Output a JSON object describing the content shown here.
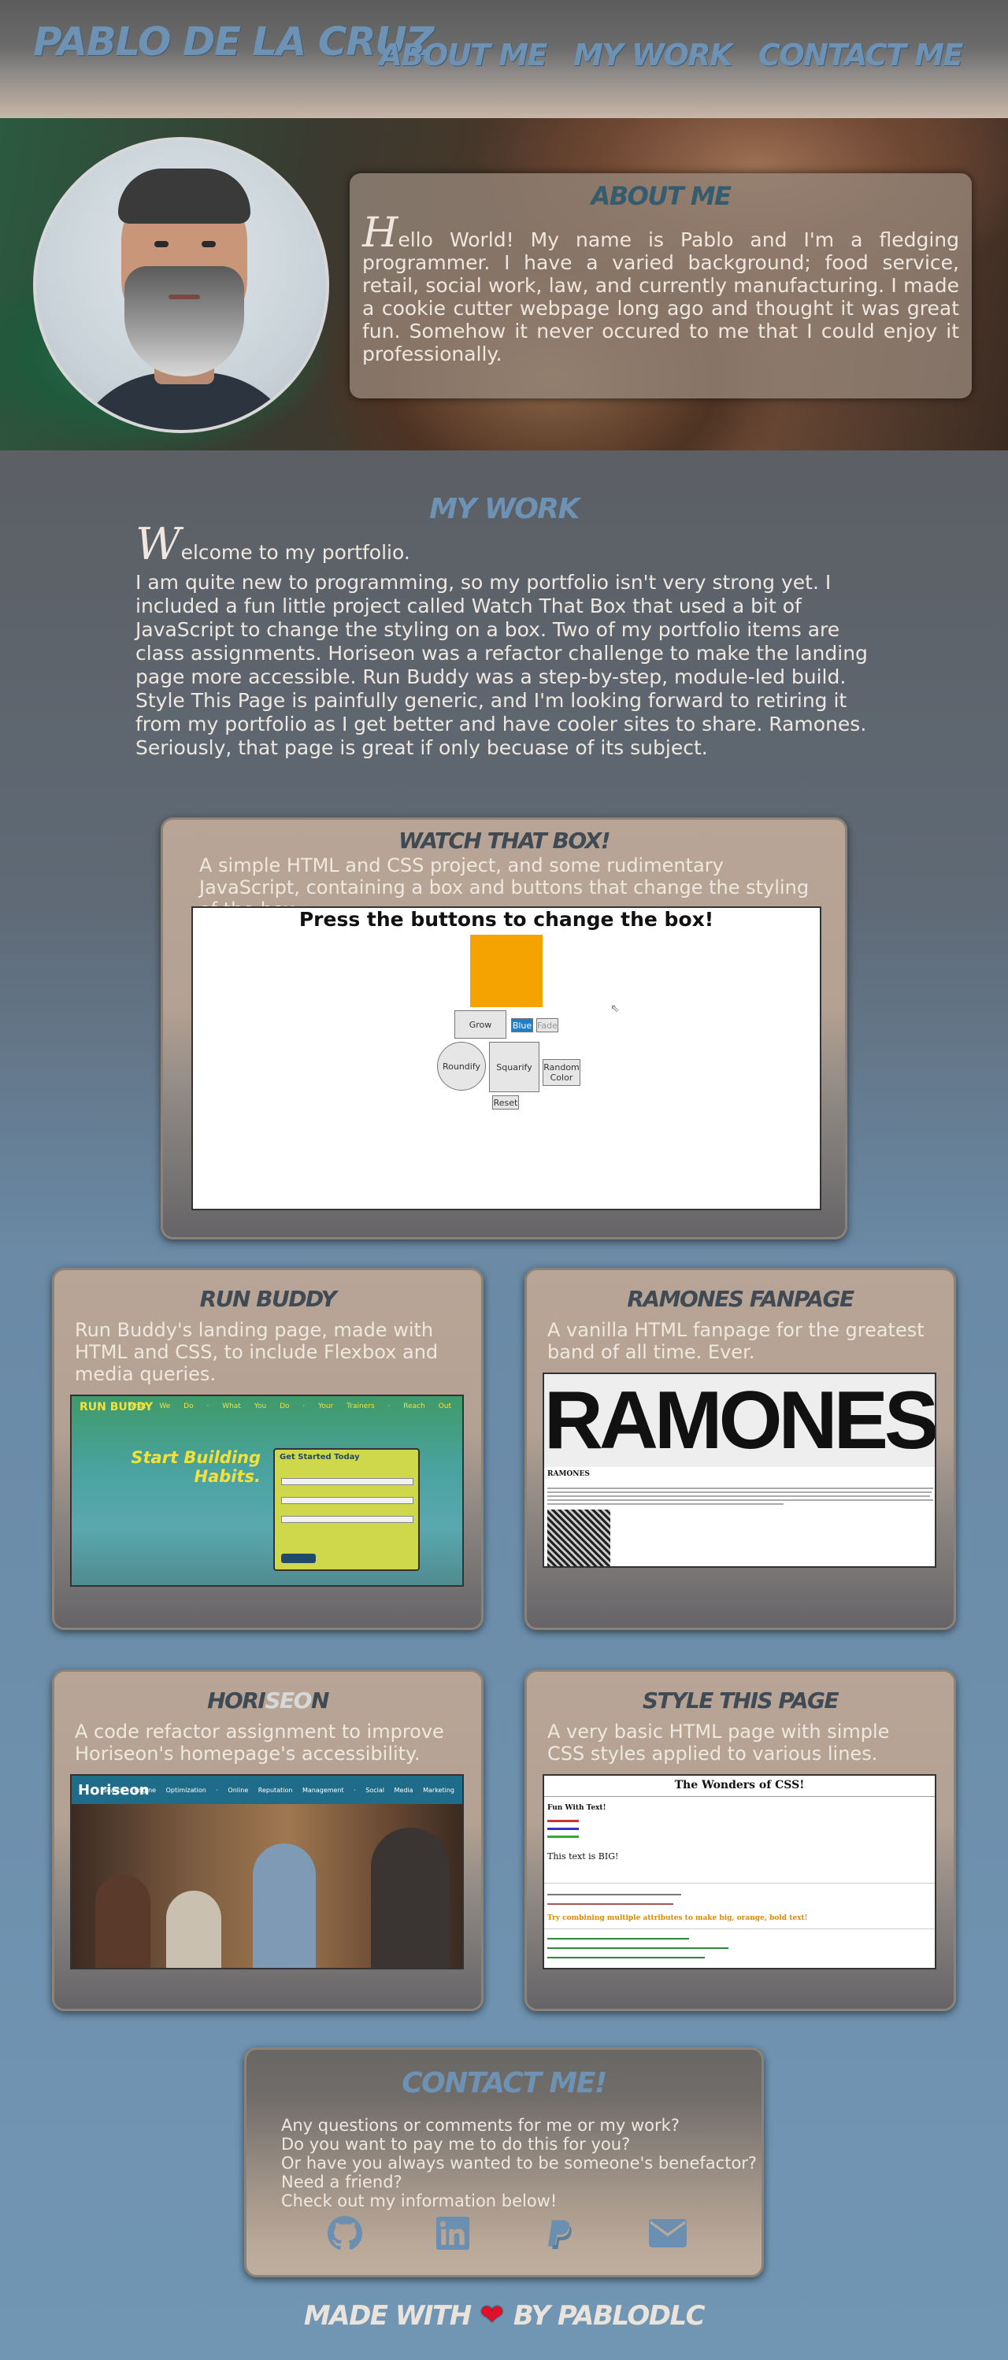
{
  "header": {
    "site_title": "PABLO DE LA CRUZ",
    "nav": [
      {
        "label": "ABOUT ME"
      },
      {
        "label": "MY WORK"
      },
      {
        "label": "CONTACT ME"
      }
    ]
  },
  "about": {
    "title": "ABOUT ME",
    "dropcap": "H",
    "text": "ello World! My name is Pablo and I'm a fledging programmer. I have a varied background; food service, retail, social work, law, and currently manufacturing. I made a cookie cutter webpage long ago and thought it was great fun. Somehow it never occured to me that I could enjoy it professionally."
  },
  "work": {
    "title": "MY WORK",
    "welcome_dropcap": "W",
    "welcome": "elcome to my portfolio.",
    "intro": "I am quite new to programming, so my portfolio isn't very strong yet. I included a fun little project called Watch That Box that used a bit of JavaScript to change the styling on a box. Two of my portfolio items are class assignments. Horiseon was a refactor challenge to make the landing page more accessible. Run Buddy was a step-by-step, module-led build. Style This Page is painfully generic, and I'm looking forward to retiring it from my portfolio as I get better and have cooler sites to share. Ramones. Seriously, that page is great if only becuase of its subject."
  },
  "projects": {
    "watch": {
      "title": "WATCH THAT BOX!",
      "desc": "A simple HTML and CSS project, and some rudimentary JavaScript, containing a box and buttons that change the styling of the box.",
      "shot": {
        "heading": "Press the buttons to change the box!",
        "grow": "Grow",
        "blue": "Blue",
        "fade": "Fade",
        "roundify": "Roundify",
        "squarify": "Squarify",
        "random": "Random Color",
        "reset": "Reset"
      }
    },
    "runbuddy": {
      "title": "RUN BUDDY",
      "desc": "Run Buddy's landing page, made with HTML and CSS, to include Flexbox and media queries.",
      "shot": {
        "logo": "RUN BUDDY",
        "nav": "What We Do · What You Do · Your Trainers · Reach Out",
        "hero": "Start Building Habits.",
        "form_title": "Get Started Today"
      }
    },
    "ramones": {
      "title": "RAMONES FANPAGE",
      "desc": "A vanilla HTML fanpage for the greatest band of all time. Ever.",
      "shot": {
        "logo": "RAMONES",
        "heading": "RAMONES"
      }
    },
    "horiseon": {
      "title_a": "HORI",
      "title_b": "SEO",
      "title_c": "N",
      "desc": "A code refactor assignment to improve Horiseon's homepage's accessibility.",
      "shot": {
        "logo": "Horiseon",
        "nav": "Search Engine Optimization · Online Reputation Management · Social Media Marketing"
      }
    },
    "stylethispage": {
      "title": "STYLE THIS PAGE",
      "desc": "A very basic HTML page with simple CSS styles applied to various lines.",
      "shot": {
        "title": "The Wonders of CSS!",
        "fun": "Fun With Text!",
        "big": "This text is BIG!",
        "combo": "Try combining multiple attributes to make big, orange, bold text!"
      }
    }
  },
  "contact": {
    "title": "CONTACT ME!",
    "lines": [
      "Any questions or comments for me or my work?",
      "Do you want to pay me to do this for you?",
      "Or have you always wanted to be someone's benefactor?",
      "Need a friend?",
      "Check out my information below!"
    ],
    "icons": [
      "github-icon",
      "linkedin-icon",
      "paypal-icon",
      "email-icon"
    ],
    "icon_color": "#6a8fb0"
  },
  "footer": {
    "made_with": "MADE WITH",
    "by": "BY PABLODLC"
  }
}
